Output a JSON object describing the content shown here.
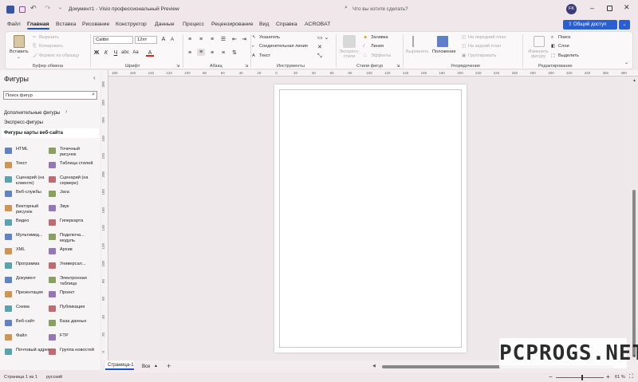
{
  "titlebar": {
    "doc_title": "Документ1 - Visio профессиональный Preview",
    "search_placeholder": "Что вы хотите сделать?",
    "user_initials": "FK"
  },
  "ribbon_tabs": [
    "Файл",
    "Главная",
    "Вставка",
    "Рисование",
    "Конструктор",
    "Данные",
    "Процесс",
    "Рецензирование",
    "Вид",
    "Справка",
    "ACROBAT"
  ],
  "share_label": "Общий доступ",
  "ribbon": {
    "clipboard": {
      "paste": "Вставить",
      "cut": "Вырезать",
      "copy": "Копировать",
      "format_painter": "Формат по образцу",
      "label": "Буфер обмена"
    },
    "font": {
      "name": "Calibri",
      "size": "12пт",
      "label": "Шрифт"
    },
    "paragraph": {
      "label": "Абзац"
    },
    "tools": {
      "pointer": "Указатель",
      "connector": "Соединительная линия",
      "text": "Текст",
      "label": "Инструменты"
    },
    "shape_styles": {
      "express": "Экспресс-стили",
      "fill": "Заливка",
      "line": "Линия",
      "effects": "Эффекты",
      "label": "Стили фигур"
    },
    "arrange": {
      "align": "Выровнять",
      "position": "Положение",
      "to_front": "На передний план",
      "to_back": "На задний план",
      "group": "Группировать",
      "label": "Упорядочение"
    },
    "editing": {
      "change_shape": "Изменить фигуру",
      "find": "Поиск",
      "layers": "Слои",
      "select": "Выделить",
      "label": "Редактирование"
    }
  },
  "shapes_pane": {
    "title": "Фигуры",
    "search_placeholder": "Поиск фигур",
    "more_shapes": "Дополнительные фигуры",
    "quick_shapes": "Экспресс-фигуры",
    "stencil": "Фигуры карты веб-сайта",
    "items": [
      [
        "HTML",
        "Точечный рисунок"
      ],
      [
        "Текст",
        "Таблица стилей"
      ],
      [
        "Сценарий (на клиенте)",
        "Сценарий (на сервере)"
      ],
      [
        "Веб-службы",
        "Java"
      ],
      [
        "Векторный рисунок",
        "Звук"
      ],
      [
        "Видео",
        "Гиперкарта"
      ],
      [
        "Мультимед...",
        "Подключа... модуль"
      ],
      [
        "XML",
        "Архив"
      ],
      [
        "Программа",
        "Универсал..."
      ],
      [
        "Документ",
        "Электронная таблица"
      ],
      [
        "Презентация",
        "Проект"
      ],
      [
        "Схема",
        "Публикация"
      ],
      [
        "Веб-сайт",
        "База данных"
      ],
      [
        "Файл",
        "FTP"
      ],
      [
        "Почтовый адрес",
        "Группа новостей"
      ]
    ]
  },
  "ruler_top": [
    "180",
    "160",
    "140",
    "120",
    "100",
    "80",
    "60",
    "40",
    "20",
    "0",
    "20",
    "40",
    "60",
    "80",
    "100",
    "120",
    "140",
    "160",
    "180",
    "200",
    "220",
    "240",
    "260",
    "280",
    "300",
    "320",
    "340",
    "360",
    "380"
  ],
  "ruler_left": [
    "300",
    "280",
    "260",
    "240",
    "220",
    "200",
    "180",
    "160",
    "140",
    "120",
    "100",
    "80",
    "60",
    "40",
    "20",
    "0"
  ],
  "page_tabs": {
    "page1": "Страница-1",
    "all": "Все"
  },
  "status": {
    "page": "Страница 1 из 1",
    "lang": "русский",
    "zoom": "61 %"
  },
  "watermark": "PCPROGS.NET"
}
